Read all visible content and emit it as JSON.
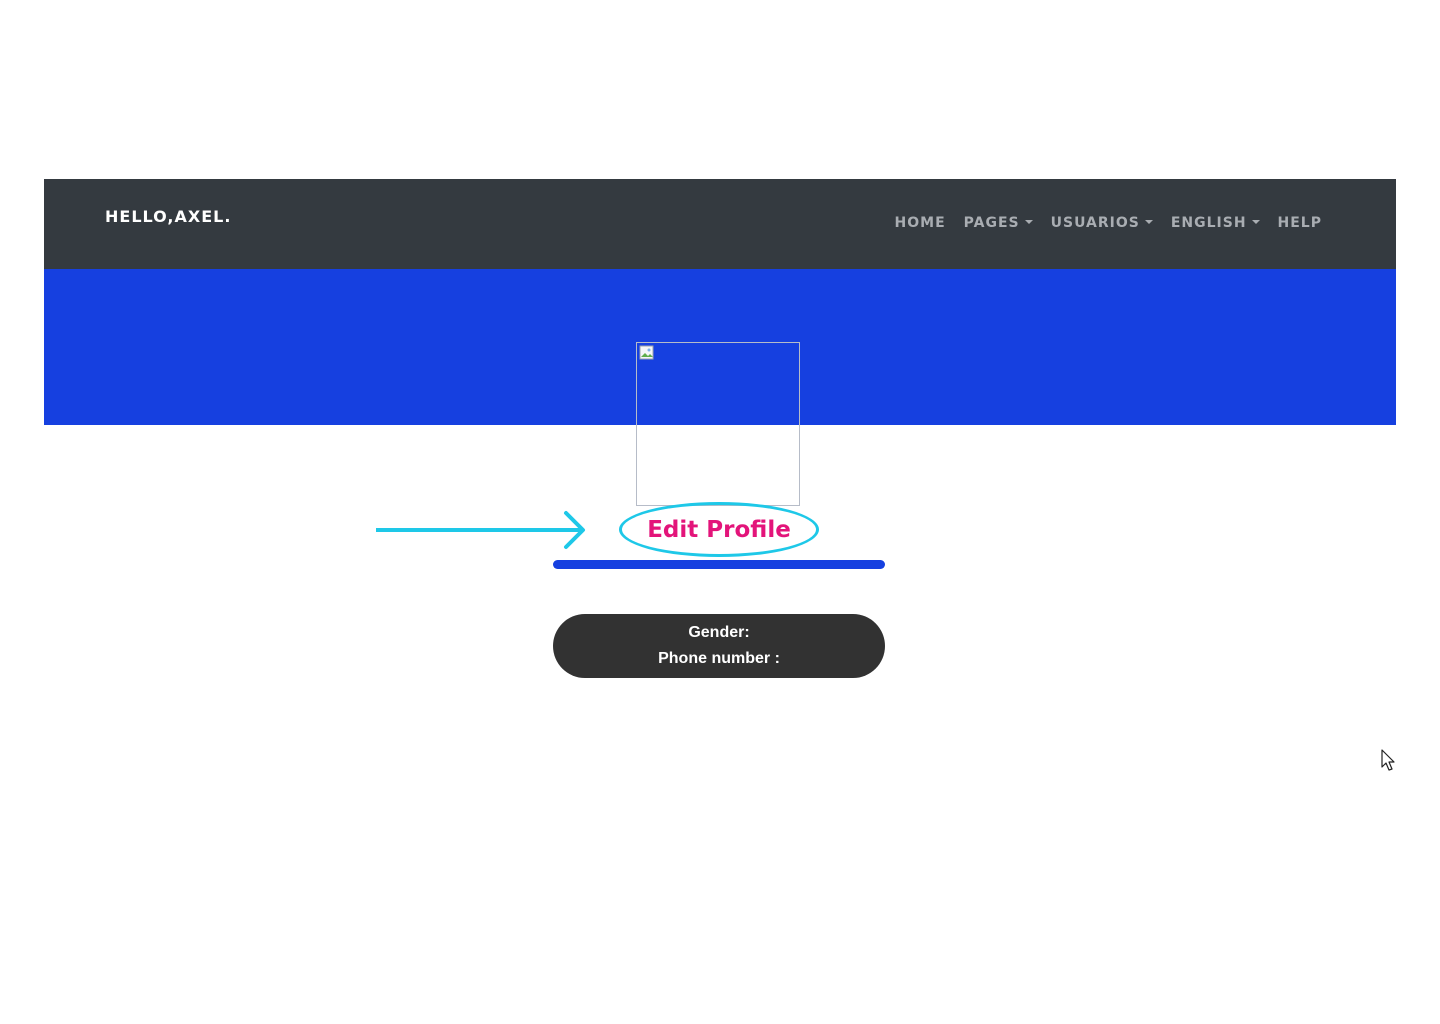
{
  "navbar": {
    "brand": "HELLO,AXEL.",
    "items": [
      {
        "label": "HOME",
        "dropdown": false
      },
      {
        "label": "PAGES",
        "dropdown": true
      },
      {
        "label": "USUARIOS",
        "dropdown": true
      },
      {
        "label": "ENGLISH",
        "dropdown": true
      },
      {
        "label": "HELP",
        "dropdown": false
      }
    ]
  },
  "profile": {
    "edit_label": "Edit Profile",
    "gender_label": "Gender:",
    "phone_label": "Phone number :"
  },
  "colors": {
    "navbar": "#343a40",
    "hero": "#1640e0",
    "edit_text": "#e3147a",
    "highlight": "#1ec8e8",
    "card": "#323232"
  }
}
